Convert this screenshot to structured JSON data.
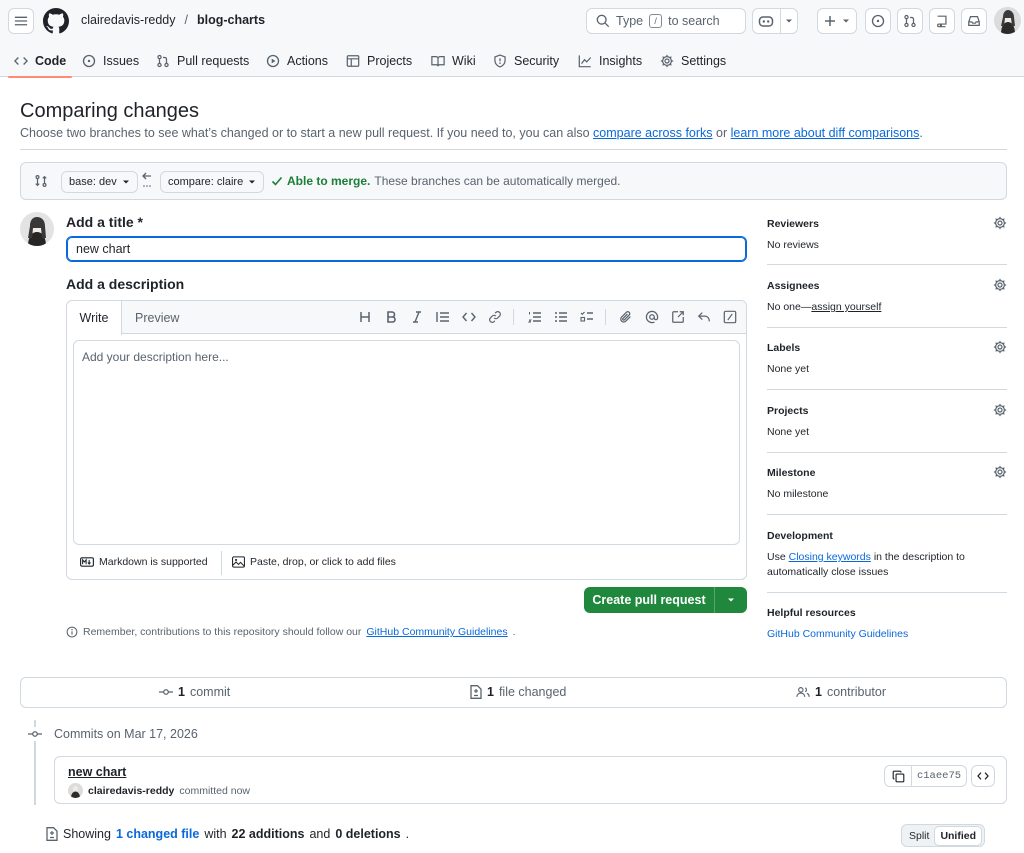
{
  "header": {
    "owner": "clairedavis-reddy",
    "separator": "/",
    "repo": "blog-charts",
    "search_prefix": "Type",
    "search_key": "/",
    "search_suffix": "to search"
  },
  "tabs": [
    {
      "label": "Code",
      "icon": "code-icon",
      "active": true
    },
    {
      "label": "Issues",
      "icon": "issue-icon"
    },
    {
      "label": "Pull requests",
      "icon": "pull-request-icon"
    },
    {
      "label": "Actions",
      "icon": "play-icon"
    },
    {
      "label": "Projects",
      "icon": "table-icon"
    },
    {
      "label": "Wiki",
      "icon": "book-icon"
    },
    {
      "label": "Security",
      "icon": "shield-icon"
    },
    {
      "label": "Insights",
      "icon": "graph-icon"
    },
    {
      "label": "Settings",
      "icon": "gear-icon"
    }
  ],
  "compare": {
    "title": "Comparing changes",
    "subtitle_text": "Choose two branches to see what’s changed or to start a new pull request. If you need to, you can also",
    "link_forks": "compare across forks",
    "or": "or",
    "link_learn": "learn more about diff comparisons",
    "period": ".",
    "base_label": "base: dev",
    "compare_label": "compare: claire",
    "merge_status": "Able to merge.",
    "merge_detail": "These branches can be automatically merged."
  },
  "form": {
    "title_label": "Add a title *",
    "title_value": "new chart",
    "desc_label": "Add a description",
    "tab_write": "Write",
    "tab_preview": "Preview",
    "desc_placeholder": "Add your description here...",
    "markdown_note": "Markdown is supported",
    "attach_note": "Paste, drop, or click to add files",
    "create_button": "Create pull request",
    "remember_text": "Remember, contributions to this repository should follow our",
    "remember_link": "GitHub Community Guidelines",
    "remember_end": "."
  },
  "sidebar": {
    "reviewers_title": "Reviewers",
    "reviewers_value": "No reviews",
    "assignees_title": "Assignees",
    "assignees_value": "No one—",
    "assignees_link": "assign yourself",
    "labels_title": "Labels",
    "labels_value": "None yet",
    "projects_title": "Projects",
    "projects_value": "None yet",
    "milestone_title": "Milestone",
    "milestone_value": "No milestone",
    "development_title": "Development",
    "development_prefix": "Use",
    "development_link": "Closing keywords",
    "development_suffix": "in the description to automatically close issues",
    "helpful_title": "Helpful resources",
    "helpful_link": "GitHub Community Guidelines"
  },
  "summary": {
    "commits_count": "1",
    "commits_label": "commit",
    "files_count": "1",
    "files_label": "file changed",
    "contributors_count": "1",
    "contributors_label": "contributor"
  },
  "commits": {
    "date_heading": "Commits on Mar 17, 2026",
    "message": "new chart",
    "author": "clairedavis-reddy",
    "when": "committed now",
    "sha": "c1aee75"
  },
  "diff": {
    "showing": "Showing",
    "changed_link": "1 changed file",
    "with": "with",
    "additions": "22 additions",
    "and": "and",
    "deletions": "0 deletions",
    "end": ".",
    "split_label": "Split",
    "unified_label": "Unified"
  },
  "colors": {
    "accent": "#0969da",
    "success": "#1a7f37",
    "primary_button": "#1f883d",
    "active_tab_underline": "#fd8c73"
  }
}
